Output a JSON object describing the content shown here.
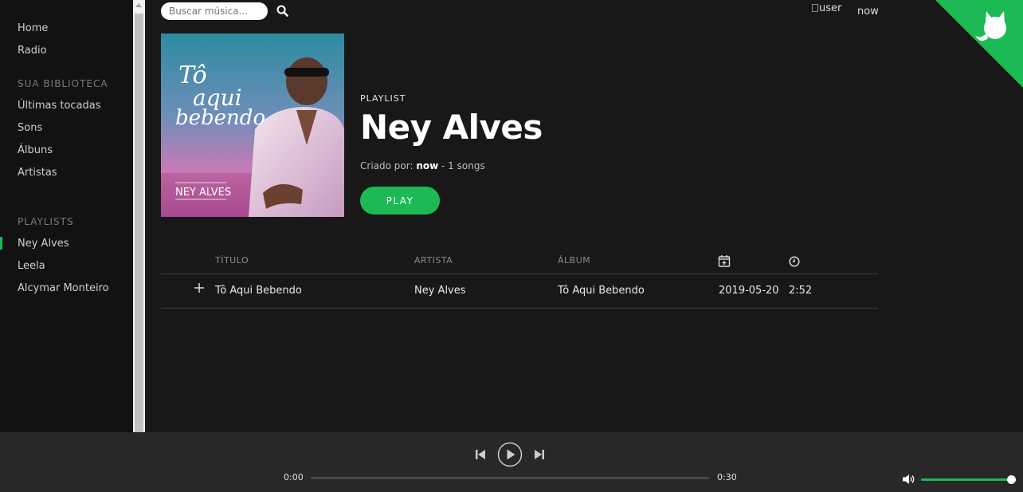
{
  "sidebar": {
    "nav": [
      {
        "label": "Home"
      },
      {
        "label": "Radio"
      }
    ],
    "library_heading": "SUA BIBLIOTECA",
    "library": [
      {
        "label": "Últimas tocadas"
      },
      {
        "label": "Sons"
      },
      {
        "label": "Álbuns"
      },
      {
        "label": "Artistas"
      }
    ],
    "playlists_heading": "PLAYLISTS",
    "playlists": [
      {
        "label": "Ney Alves",
        "active": true
      },
      {
        "label": "Leela"
      },
      {
        "label": "Alcymar Monteiro"
      }
    ]
  },
  "search": {
    "placeholder": "Buscar música..."
  },
  "user": {
    "avatar_alt": "user",
    "name": "now"
  },
  "playlist": {
    "type": "PLAYLIST",
    "title": "Ney Alves",
    "created_by_label": "Criado por:",
    "owner": "now",
    "song_count": "- 1 songs",
    "play_label": "PLAY",
    "cover_text": {
      "line1": "Tô",
      "line2": "aqui",
      "line3": "bebendo",
      "artist": "NEY ALVES"
    }
  },
  "tracks": {
    "headers": {
      "title": "TÍTULO",
      "artist": "ARTISTA",
      "album": "ÁLBUM"
    },
    "rows": [
      {
        "title": "Tô Aqui Bebendo",
        "artist": "Ney Alves",
        "album": "Tô Aqui Bebendo",
        "date": "2019-05-20",
        "duration": "2:52"
      }
    ]
  },
  "player": {
    "current_time": "0:00",
    "total_time": "0:30",
    "progress": 0,
    "volume": 1.0
  },
  "colors": {
    "accent": "#1db954",
    "sidebar_bg": "#121212",
    "main_bg": "#181818",
    "player_bg": "#282828"
  }
}
